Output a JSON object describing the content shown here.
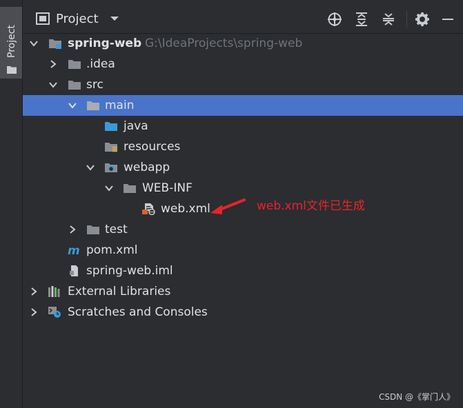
{
  "toolwindow": {
    "side_tab_label": "Project"
  },
  "header": {
    "title": "Project",
    "buttons": [
      "locate-icon",
      "expand-all-icon",
      "collapse-all-icon",
      "gear-icon",
      "minimize-icon"
    ]
  },
  "tree": {
    "root": {
      "label": "spring-web",
      "path": "G:\\IdeaProjects\\spring-web"
    },
    "idea": {
      "label": ".idea"
    },
    "src": {
      "label": "src"
    },
    "main": {
      "label": "main"
    },
    "java": {
      "label": "java"
    },
    "resources": {
      "label": "resources"
    },
    "webapp": {
      "label": "webapp"
    },
    "webinf": {
      "label": "WEB-INF"
    },
    "webxml": {
      "label": "web.xml"
    },
    "test": {
      "label": "test"
    },
    "pom": {
      "label": "pom.xml"
    },
    "iml": {
      "label": "spring-web.iml"
    },
    "extlibs": {
      "label": "External Libraries"
    },
    "scratches": {
      "label": "Scratches and Consoles"
    }
  },
  "annotation": {
    "text": "web.xml文件已生成",
    "color": "#e8242a"
  },
  "watermark": {
    "text": "CSDN @《掌门人》"
  },
  "colors": {
    "selection": "#4a74c9",
    "background": "#2b2d30",
    "folder": "#8a8e94",
    "source_folder": "#3a9ad9"
  }
}
